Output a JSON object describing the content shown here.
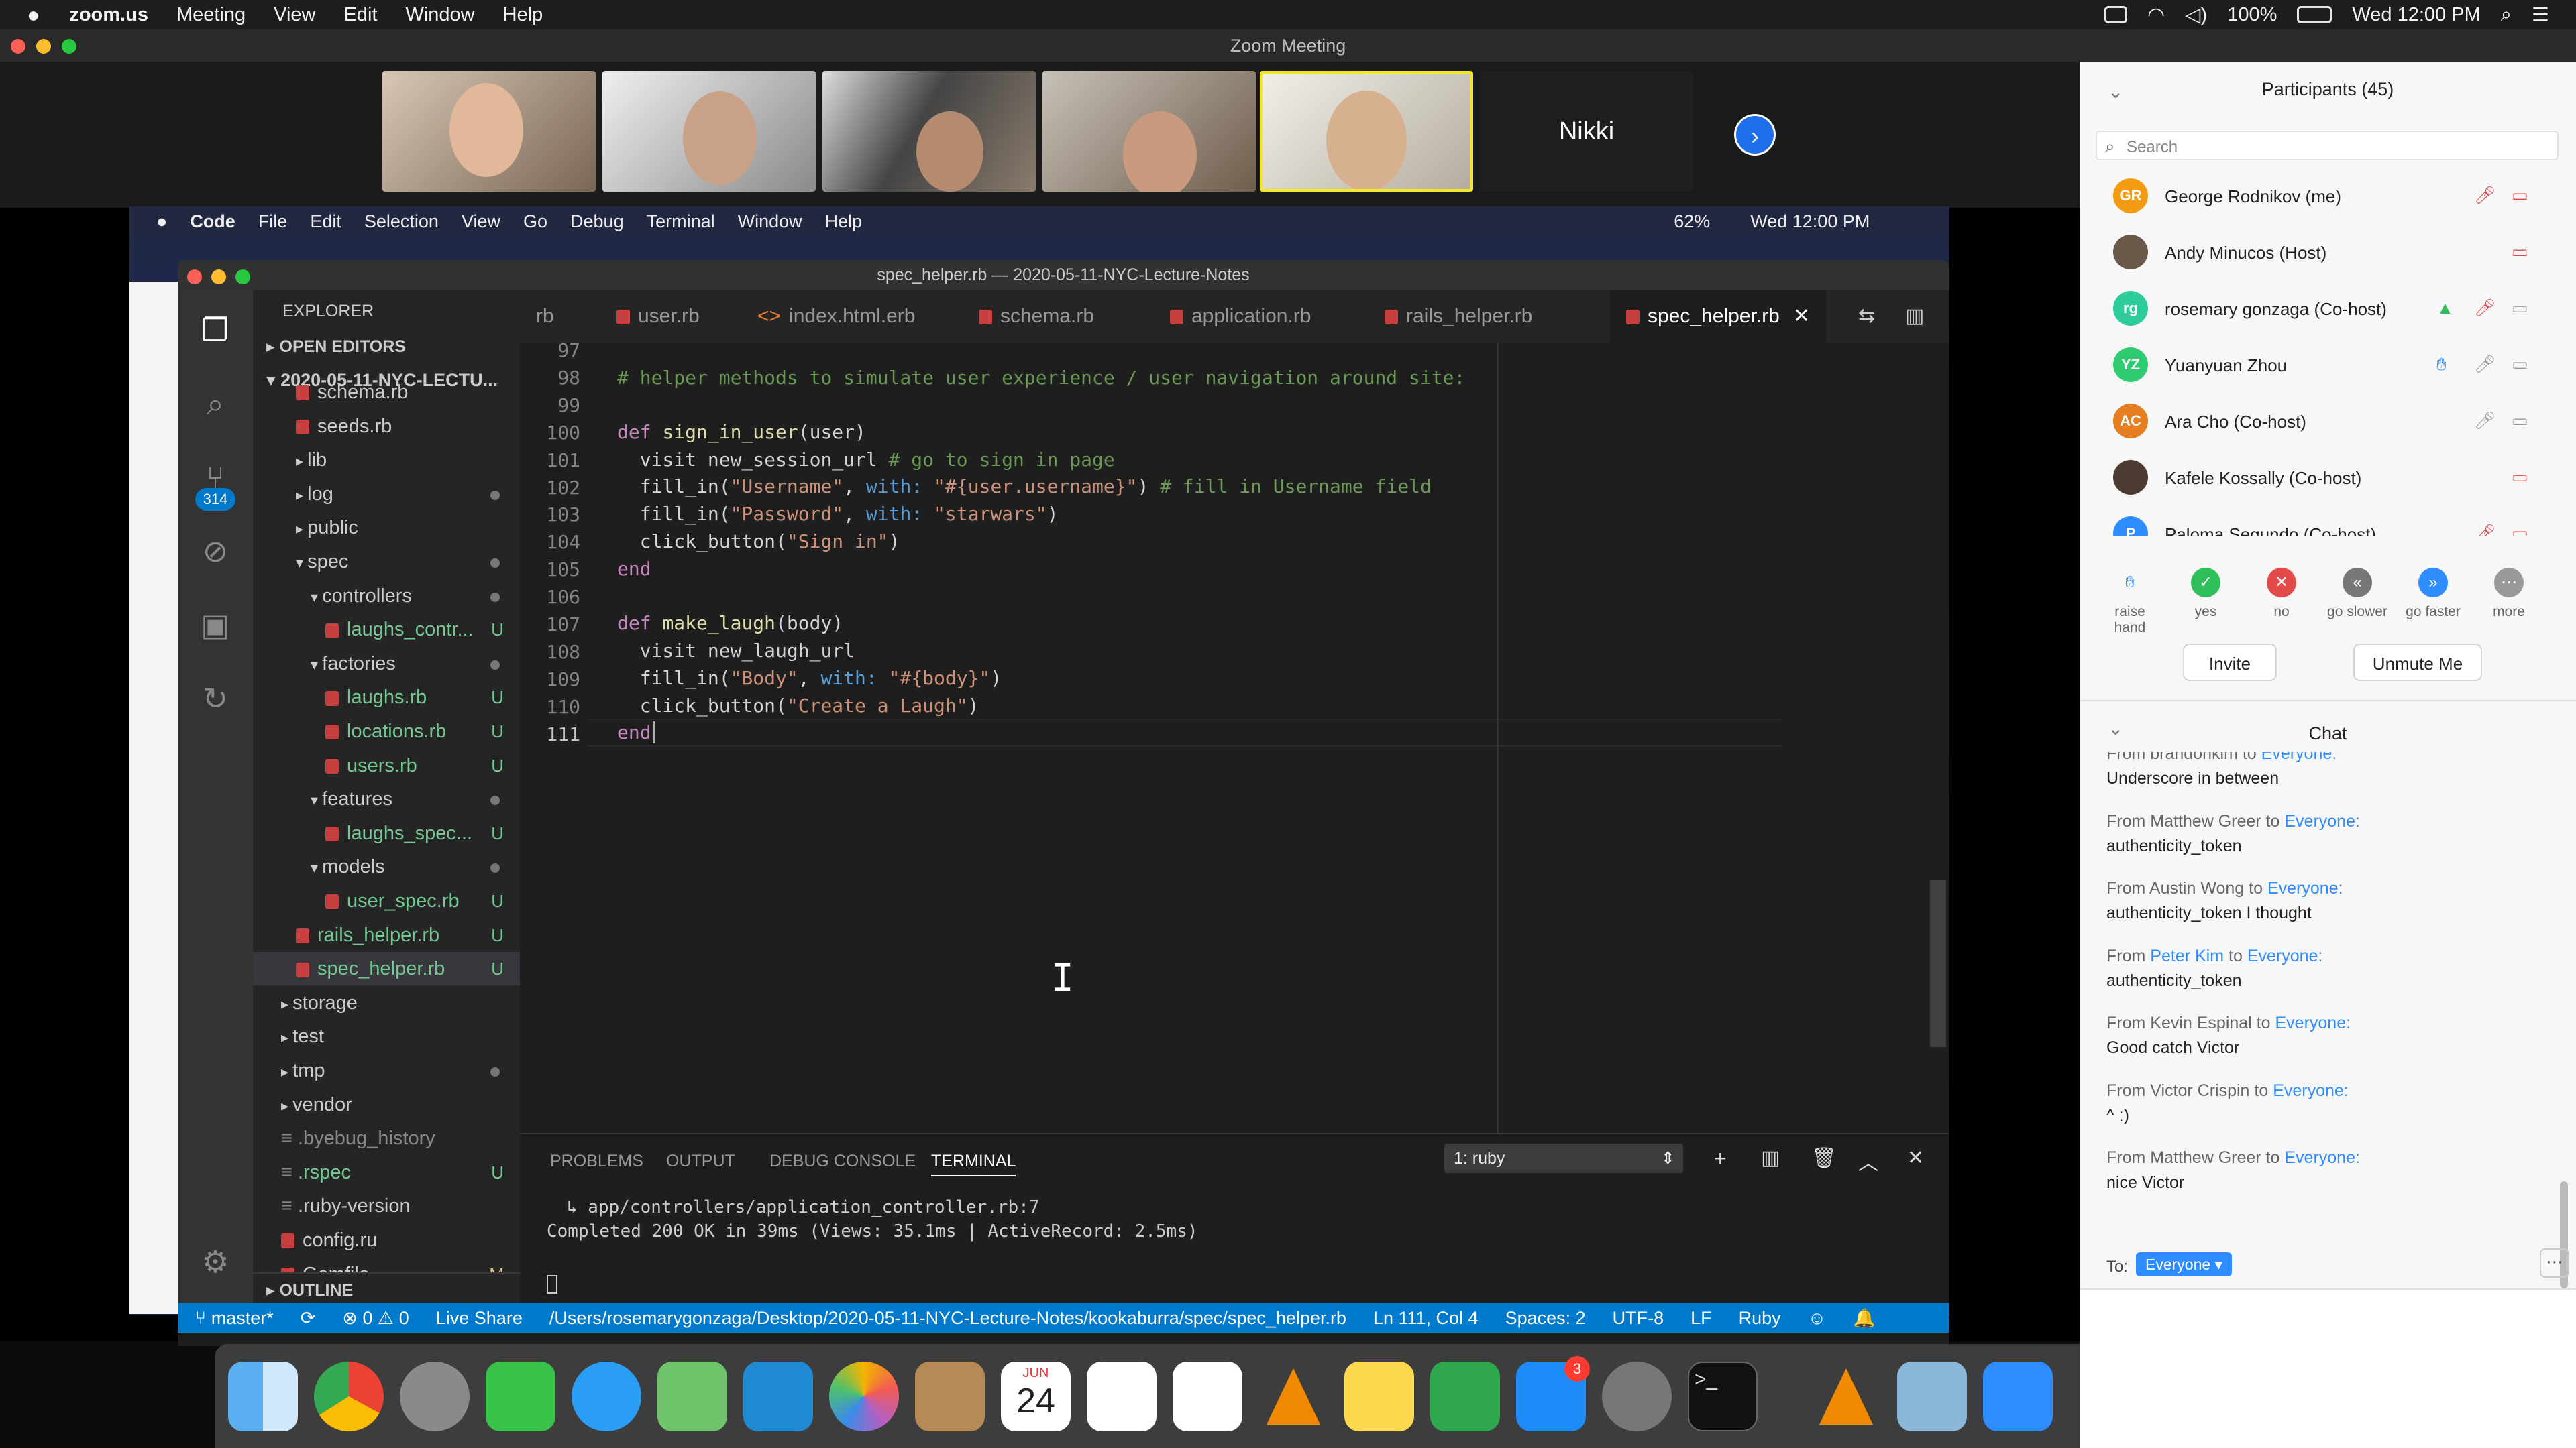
{
  "mac_menubar": {
    "app": "zoom.us",
    "menus": [
      "Meeting",
      "View",
      "Edit",
      "Window",
      "Help"
    ],
    "battery": "100%",
    "clock": "Wed 12:00 PM"
  },
  "zoom_window": {
    "title": "Zoom Meeting"
  },
  "video_strip": {
    "name_tile": "Nikki"
  },
  "inner_mac_menubar": {
    "app": "Code",
    "menus": [
      "File",
      "Edit",
      "Selection",
      "View",
      "Go",
      "Debug",
      "Terminal",
      "Window",
      "Help"
    ],
    "battery": "62%",
    "clock": "Wed 12:00 PM"
  },
  "vscode": {
    "window_title": "spec_helper.rb — 2020-05-11-NYC-Lecture-Notes",
    "badge_count": "314",
    "explorer": {
      "title": "EXPLORER",
      "open_editors": "OPEN EDITORS",
      "project": "2020-05-11-NYC-LECTU...",
      "items": [
        {
          "label": "schema.rb",
          "status": ""
        },
        {
          "label": "seeds.rb",
          "status": ""
        },
        {
          "label": "lib",
          "status": ""
        },
        {
          "label": "log",
          "status": "dot"
        },
        {
          "label": "public",
          "status": ""
        },
        {
          "label": "spec",
          "status": "dot"
        },
        {
          "label": "controllers",
          "status": "dot"
        },
        {
          "label": "laughs_contr...",
          "status": "U"
        },
        {
          "label": "factories",
          "status": "dot"
        },
        {
          "label": "laughs.rb",
          "status": "U"
        },
        {
          "label": "locations.rb",
          "status": "U"
        },
        {
          "label": "users.rb",
          "status": "U"
        },
        {
          "label": "features",
          "status": "dot"
        },
        {
          "label": "laughs_spec...",
          "status": "U"
        },
        {
          "label": "models",
          "status": "dot"
        },
        {
          "label": "user_spec.rb",
          "status": "U"
        },
        {
          "label": "rails_helper.rb",
          "status": "U"
        },
        {
          "label": "spec_helper.rb",
          "status": "U"
        },
        {
          "label": "storage",
          "status": ""
        },
        {
          "label": "test",
          "status": ""
        },
        {
          "label": "tmp",
          "status": "dot"
        },
        {
          "label": "vendor",
          "status": ""
        },
        {
          "label": ".byebug_history",
          "status": ""
        },
        {
          "label": ".rspec",
          "status": "U"
        },
        {
          "label": ".ruby-version",
          "status": ""
        },
        {
          "label": "config.ru",
          "status": ""
        },
        {
          "label": "Gemfile",
          "status": "M"
        }
      ],
      "outline": "OUTLINE"
    },
    "tabs": [
      "rb",
      "user.rb",
      "index.html.erb",
      "schema.rb",
      "application.rb",
      "rails_helper.rb",
      "spec_helper.rb"
    ],
    "line_numbers": [
      "97",
      "98",
      "99",
      "100",
      "101",
      "102",
      "103",
      "104",
      "105",
      "106",
      "107",
      "108",
      "109",
      "110",
      "111"
    ],
    "code": {
      "l98": "# helper methods to simulate user experience / user navigation around site:",
      "l100_kw": "def",
      "l100_fn": "sign_in_user",
      "l100_rest": "(user)",
      "l101": "visit new_session_url",
      "l101_cm": "# go to sign in page",
      "l102_a": "fill_in(",
      "l102_s1": "\"Username\"",
      "l102_b": ", ",
      "l102_w": "with:",
      "l102_s2": "\"#{user.username}\"",
      "l102_c": ")",
      "l102_cm": "# fill in Username field",
      "l103_a": "fill_in(",
      "l103_s1": "\"Password\"",
      "l103_b": ", ",
      "l103_w": "with:",
      "l103_s2": "\"starwars\"",
      "l103_c": ")",
      "l104_a": "click_button(",
      "l104_s": "\"Sign in\"",
      "l104_c": ")",
      "l105": "end",
      "l107_kw": "def",
      "l107_fn": "make_laugh",
      "l107_rest": "(body)",
      "l108": "visit new_laugh_url",
      "l109_a": "fill_in(",
      "l109_s1": "\"Body\"",
      "l109_b": ", ",
      "l109_w": "with:",
      "l109_s2": "\"#{body}\"",
      "l109_c": ")",
      "l110_a": "click_button(",
      "l110_s": "\"Create a Laugh\"",
      "l110_c": ")",
      "l111": "end"
    },
    "panel": {
      "tabs": [
        "PROBLEMS",
        "OUTPUT",
        "DEBUG CONSOLE",
        "TERMINAL"
      ],
      "terminal_select": "1: ruby",
      "lines": [
        "↳ app/controllers/application_controller.rb:7",
        "Completed 200 OK in 39ms (Views: 35.1ms | ActiveRecord: 2.5ms)"
      ]
    },
    "status_bar": {
      "branch": "master*",
      "errors": "0",
      "warnings": "0",
      "live_share": "Live Share",
      "path": "/Users/rosemarygonzaga/Desktop/2020-05-11-NYC-Lecture-Notes/kookaburra/spec/spec_helper.rb",
      "position": "Ln 111, Col 4",
      "spaces": "Spaces: 2",
      "encoding": "UTF-8",
      "eol": "LF",
      "language": "Ruby"
    }
  },
  "participants": {
    "title": "Participants (45)",
    "search_placeholder": "Search",
    "list": [
      {
        "initials": "GR",
        "name": "George Rodnikov (me)",
        "color": "#f39c12"
      },
      {
        "initials": "",
        "name": "Andy Minucos (Host)",
        "color": "#6b5a4a"
      },
      {
        "initials": "rg",
        "name": "rosemary gonzaga (Co-host)",
        "color": "#2ecc9a"
      },
      {
        "initials": "YZ",
        "name": "Yuanyuan Zhou",
        "color": "#2ecc71"
      },
      {
        "initials": "AC",
        "name": "Ara Cho (Co-host)",
        "color": "#e67e22"
      },
      {
        "initials": "",
        "name": "Kafele Kossally (Co-host)",
        "color": "#4a3a30"
      },
      {
        "initials": "P",
        "name": "Paloma Segundo (Co-host)",
        "color": "#2d8cff"
      }
    ],
    "reactions": [
      "raise hand",
      "yes",
      "no",
      "go slower",
      "go faster",
      "more"
    ],
    "invite": "Invite",
    "unmute": "Unmute Me"
  },
  "chat": {
    "title": "Chat",
    "messages": [
      {
        "from": "From brandonkim to",
        "to": "Everyone:",
        "text": "Underscore in between"
      },
      {
        "from": "From Matthew Greer to",
        "to": "Everyone:",
        "text": "authenticity_token"
      },
      {
        "from": "From Austin Wong to",
        "to": "Everyone:",
        "text": "authenticity_token I thought"
      },
      {
        "from": "From",
        "sender": "Peter Kim",
        "from2": "to",
        "to": "Everyone:",
        "text": "authenticity_token"
      },
      {
        "from": "From Kevin Espinal to",
        "to": "Everyone:",
        "text": "Good catch Victor"
      },
      {
        "from": "From Victor Crispin to",
        "to": "Everyone:",
        "text": "^ :)"
      },
      {
        "from": "From Matthew Greer to",
        "to": "Everyone:",
        "text": "nice Victor"
      }
    ],
    "to_label": "To:",
    "to_value": "Everyone"
  },
  "dock": {
    "calendar_month": "JUN",
    "calendar_day": "24",
    "appstore_badge": "3"
  }
}
